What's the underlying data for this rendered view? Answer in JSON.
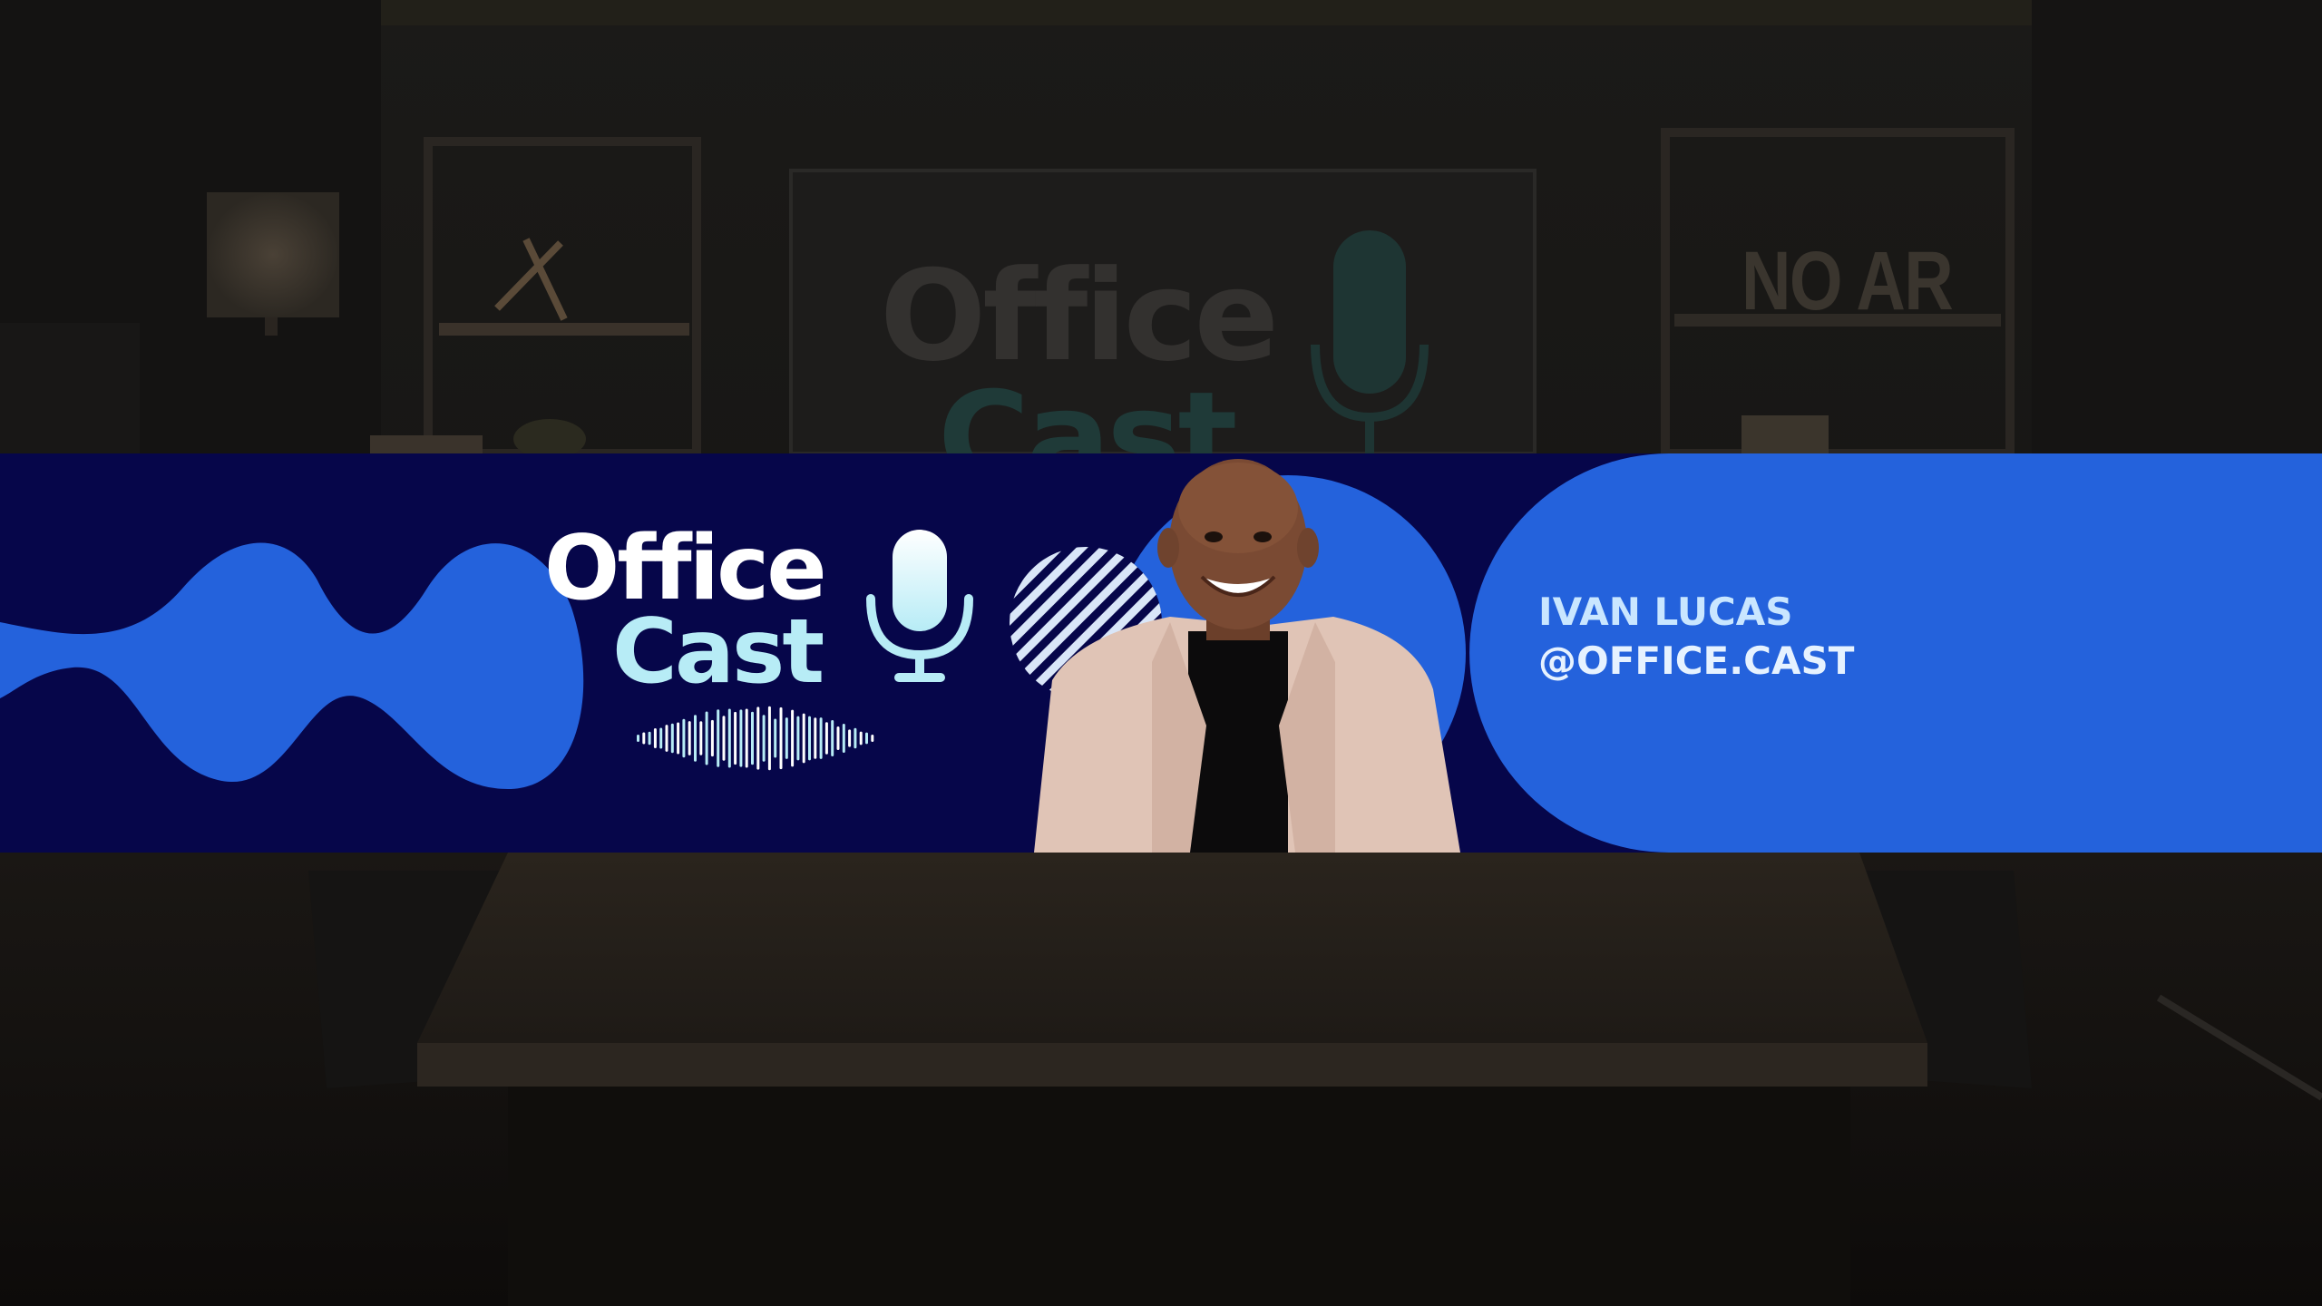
{
  "logo": {
    "line1": "Office",
    "line2": "Cast"
  },
  "background_sign": {
    "line1": "Office",
    "line2": "Cast",
    "shelf_sign": "NO AR"
  },
  "host": {
    "name": "IVAN LUCAS",
    "handle": "@OFFICE.CAST"
  },
  "colors": {
    "band_navy": "#06064a",
    "accent_blue": "#2462dc",
    "logo_white": "#ffffff",
    "logo_cyan": "#b7ecf6",
    "text_light_blue": "#c9e6ff"
  },
  "icons": [
    "microphone-icon",
    "sound-wave-icon"
  ]
}
